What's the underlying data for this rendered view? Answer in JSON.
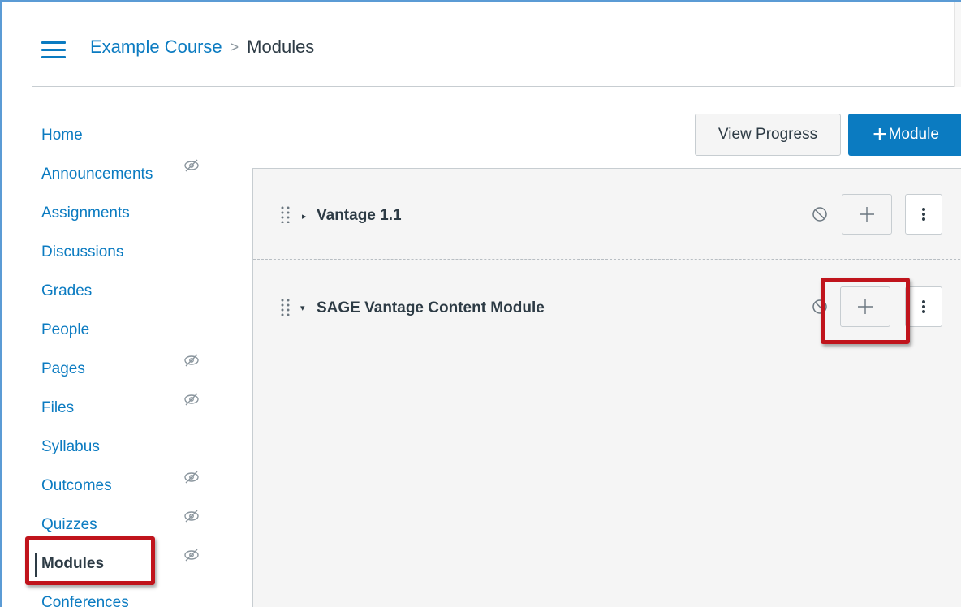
{
  "header": {
    "breadcrumb_course": "Example Course",
    "breadcrumb_separator": ">",
    "breadcrumb_current": "Modules"
  },
  "sidebar": {
    "items": [
      {
        "label": "Home",
        "hidden_icon": false
      },
      {
        "label": "Announcements",
        "hidden_icon": true
      },
      {
        "label": "Assignments",
        "hidden_icon": false
      },
      {
        "label": "Discussions",
        "hidden_icon": false
      },
      {
        "label": "Grades",
        "hidden_icon": false
      },
      {
        "label": "People",
        "hidden_icon": false
      },
      {
        "label": "Pages",
        "hidden_icon": true
      },
      {
        "label": "Files",
        "hidden_icon": true
      },
      {
        "label": "Syllabus",
        "hidden_icon": false
      },
      {
        "label": "Outcomes",
        "hidden_icon": true
      },
      {
        "label": "Quizzes",
        "hidden_icon": true
      },
      {
        "label": "Modules",
        "hidden_icon": true,
        "active": true
      },
      {
        "label": "Conferences",
        "hidden_icon": false
      }
    ]
  },
  "toolbar": {
    "view_progress_label": "View Progress",
    "add_module_plus": "+",
    "add_module_label": "Module"
  },
  "modules": [
    {
      "title": "Vantage 1.1",
      "expanded": false
    },
    {
      "title": "SAGE Vantage Content Module",
      "expanded": true
    }
  ],
  "icons": {
    "menu": "hamburger-icon",
    "hidden": "eye-slash-icon",
    "drag": "drag-handle-icon",
    "unpublished": "ban-icon",
    "add": "plus-icon",
    "more": "kebab-icon"
  },
  "colors": {
    "link": "#0b7bc1",
    "primary_button": "#0b7bc1",
    "highlight": "#c0141c",
    "panel_bg": "#f5f5f5"
  }
}
